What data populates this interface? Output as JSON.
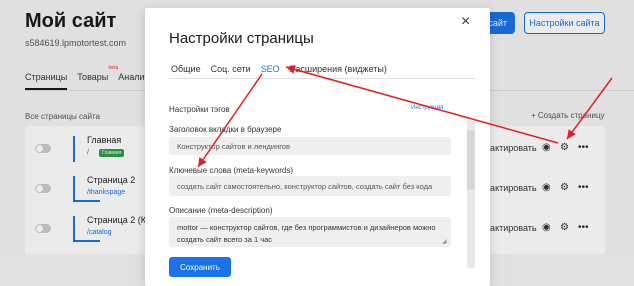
{
  "background": {
    "site_title": "Мой сайт",
    "site_domain": "s584619.lpmotortest.com",
    "btn_publish_partial": "ь сайт",
    "btn_settings": "Настройки сайта",
    "tabs": [
      {
        "label": "Страницы"
      },
      {
        "label": "Товары",
        "badge": "beta"
      },
      {
        "label": "Аналит"
      }
    ],
    "section_title": "Все страницы сайта",
    "create_page": "+ Создать страницу",
    "rows": [
      {
        "name": "Главная",
        "url": "/",
        "badge": "Главная",
        "edit": "едактировать"
      },
      {
        "name": "Страница 2",
        "url": "/thankspage",
        "edit": "едактировать"
      },
      {
        "name": "Страница 2 (Ко",
        "url": "/catalog",
        "edit": "едактировать"
      }
    ]
  },
  "modal": {
    "title": "Настройки страницы",
    "close": "×",
    "tabs": [
      {
        "label": "Общие"
      },
      {
        "label": "Соц. сети"
      },
      {
        "label": "SEO"
      },
      {
        "label": "Расширения (виджеты)"
      }
    ],
    "active_tab": "SEO",
    "tags_heading": "Настройки тэгов",
    "instructions_link": "Инструкция",
    "fields": {
      "tab_title_label": "Заголовок вкладки в браузере",
      "tab_title_value": "Конструктор сайтов и лендингов",
      "keywords_label": "Ключевые слова (meta-keywords)",
      "keywords_value": "создать сайт самостоятельно, конструктор сайтов, создать сайт без кода",
      "description_label": "Описание (meta-description)",
      "description_value": "mottor — конструктор сайтов, где без программистов и дизайнеров можно создать сайт всего за 1 час"
    },
    "save_button": "Сохранить"
  },
  "colors": {
    "accent": "#1a73e8",
    "annotation_arrow": "#e02020",
    "badge_green": "#2e9e4b"
  },
  "icons": [
    "close-icon",
    "eye-icon",
    "gear-icon",
    "more-icon",
    "toggle-icon",
    "resize-handle-icon"
  ]
}
